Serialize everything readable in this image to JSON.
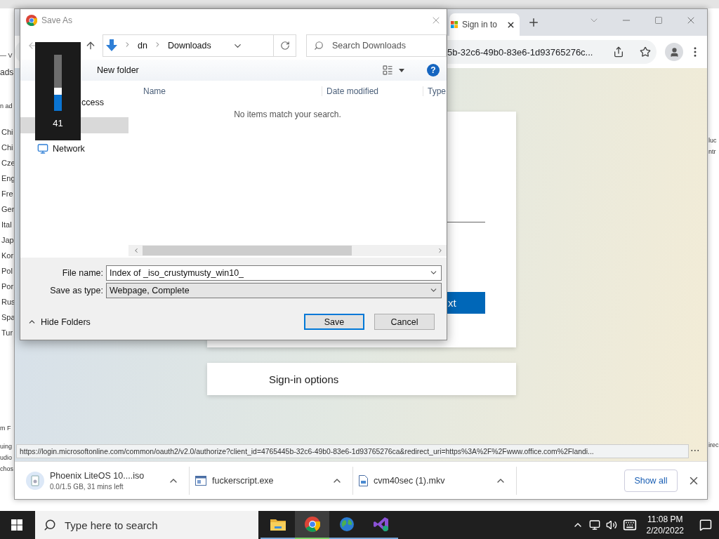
{
  "background_window": {
    "top_fragments": [
      "— V",
      "ads",
      "n ad"
    ],
    "list_fragments": [
      "Chi",
      "Chi",
      "Cze",
      "Eng",
      "Fre",
      "Ger",
      "Ital",
      "Jap",
      "Kor",
      "Pol",
      "Por",
      "Rus",
      "Spa",
      "Tur"
    ],
    "bottom_fragments": [
      "m F",
      "uing",
      "udio",
      "chos"
    ],
    "right_fragments": [
      "luc",
      "ntr",
      "irec"
    ]
  },
  "browser": {
    "tab": {
      "title": "Sign in to"
    },
    "address": "5b-32c6-49b0-83e6-1d93765276c...",
    "page": {
      "next_button": "xt",
      "sign_in_options": "Sign-in options"
    },
    "status_url": "https://login.microsoftonline.com/common/oauth2/v2.0/authorize?client_id=4765445b-32c6-49b0-83e6-1d93765276ca&redirect_uri=https%3A%2F%2Fwww.office.com%2Flandi...",
    "status_more": "⋯",
    "downloads": [
      {
        "kind": "disc",
        "name": "Phoenix LiteOS 10....iso",
        "status": "0.0/1.5 GB, 31 mins left"
      },
      {
        "kind": "program",
        "name": "fuckerscript.exe"
      },
      {
        "kind": "document",
        "name": "cvm40sec (1).mkv"
      }
    ],
    "show_all": "Show all"
  },
  "dialog": {
    "title": "Save As",
    "breadcrumb": [
      "dn",
      "Downloads"
    ],
    "search": {
      "placeholder": "Search Downloads"
    },
    "new_folder": "New folder",
    "help": "?",
    "sidebar": [
      {
        "label": "ccess",
        "selected": false
      },
      {
        "selected": true
      },
      {
        "label": "Network",
        "selected": false
      }
    ],
    "columns": [
      "Name",
      "Date modified",
      "Type"
    ],
    "empty_message": "No items match your search.",
    "file_name_label": "File name:",
    "file_name": "Index of _iso_crustymusty_win10_",
    "type_label": "Save as type:",
    "type": "Webpage, Complete",
    "hide_folders": "Hide Folders",
    "buttons": [
      "Save",
      "Cancel"
    ]
  },
  "volume_osd": {
    "level": 0.41,
    "reading": "41"
  },
  "taskbar": {
    "search": {
      "placeholder": "Type here to search"
    },
    "apps": [
      {
        "kind": "folder",
        "selected": false
      },
      {
        "kind": "chrome",
        "selected": true
      },
      {
        "kind": "globe",
        "selected": false
      },
      {
        "kind": "studio",
        "selected": false
      }
    ],
    "time": "11:08 PM",
    "date": "2/20/2022"
  }
}
